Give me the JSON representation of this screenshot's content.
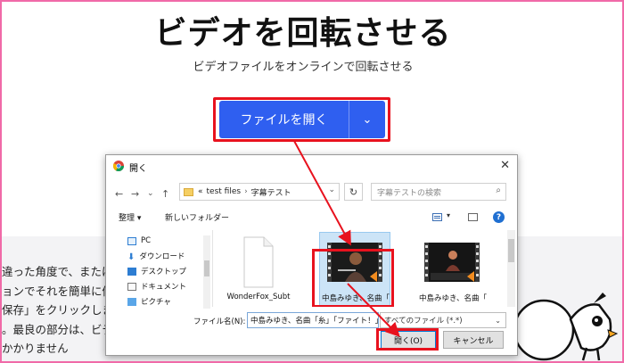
{
  "hero": {
    "title": "ビデオを回転させる",
    "subtitle": "ビデオファイルをオンラインで回転させる",
    "open_button_label": "ファイルを開く",
    "open_button_caret": "⌄"
  },
  "body_text": {
    "lines": [
      "違った角度で、または",
      "ョンでそれを簡単に修",
      "保存」をクリックしま",
      "。最良の部分は、ビデ",
      "かかりません"
    ]
  },
  "dialog": {
    "title": "開く",
    "close_glyph": "✕",
    "nav": {
      "back": "←",
      "forward": "→",
      "dropdown": "⌄",
      "up": "↑"
    },
    "address": {
      "prefix": "«",
      "segments": [
        "test files",
        "字幕テスト"
      ],
      "separator": "›",
      "dropdown": "⌄",
      "refresh": "↻"
    },
    "search": {
      "placeholder": "字幕テストの検索",
      "icon": "search-icon"
    },
    "toolbar": {
      "organize": "整理 ▾",
      "new_folder": "新しいフォルダー",
      "view_caret": "▾",
      "help": "?"
    },
    "nav_pane": {
      "items": [
        {
          "label": "PC",
          "icon": "pc-icon"
        },
        {
          "label": "ダウンロード",
          "icon": "download-icon"
        },
        {
          "label": "デスクトップ",
          "icon": "desktop-icon"
        },
        {
          "label": "ドキュメント",
          "icon": "documents-icon"
        },
        {
          "label": "ピクチャ",
          "icon": "pictures-icon"
        }
      ]
    },
    "files": [
      {
        "label": "WonderFox_Subt",
        "type": "document",
        "selected": false
      },
      {
        "label": "中島みゆき、名曲「",
        "type": "video",
        "selected": true
      },
      {
        "label": "中島みゆき、名曲「",
        "type": "video",
        "selected": false
      }
    ],
    "filename_label": "ファイル名(N):",
    "filename_value": "中島みゆき、名曲「糸」「ファイト！」",
    "filetype_value": "すべてのファイル (*.*)",
    "filetype_caret": "⌄",
    "open_button": "開く(O)",
    "cancel_button": "キャンセル"
  },
  "colors": {
    "primary_button": "#2f5ff0",
    "highlight_red": "#e8121e",
    "page_border": "#f06aa8"
  }
}
